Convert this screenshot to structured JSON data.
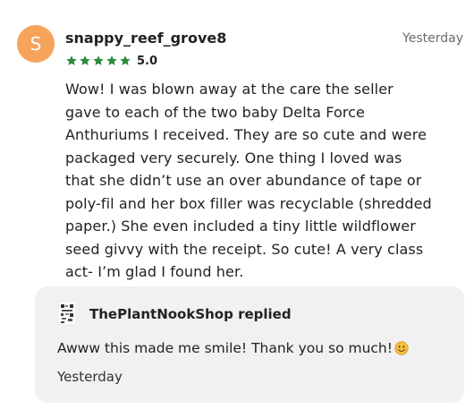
{
  "review": {
    "avatar_letter": "S",
    "username": "snappy_reef_grove8",
    "timestamp": "Yesterday",
    "rating": "5.0",
    "stars": 5,
    "text": "Wow! I was blown away at the care the seller gave to each of the two baby Delta Force Anthuriums I received. They are so cute and were packaged very securely. One thing I loved was that she didn’t use an over abundance of tape or poly-fil and her box filler was recyclable (shredded paper.) She even included a tiny little wildflower seed givvy with the receipt. So cute! A very class act- I’m glad I found her."
  },
  "reply": {
    "shop_name": "ThePlantNookShop replied",
    "text": "Awww this made me smile! Thank you so much!",
    "timestamp": "Yesterday",
    "emoji": "smiling-face-icon"
  },
  "colors": {
    "avatar": "#f6a35c",
    "star": "#2b8a3e",
    "reply_background": "#f1f1f1",
    "emoji": "#f5c242"
  }
}
